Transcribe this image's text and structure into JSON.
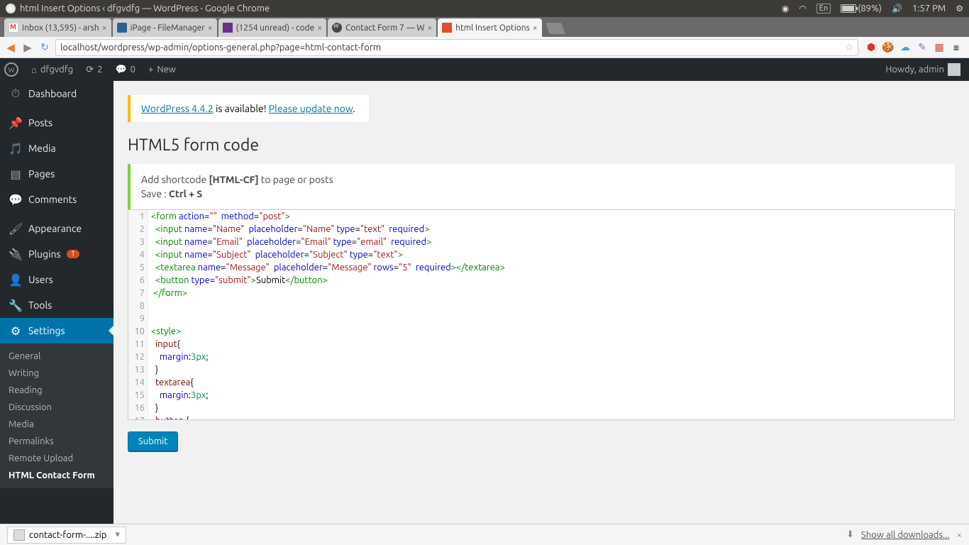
{
  "ubuntu": {
    "window_title": "html Insert Options ‹ dfgvdfg — WordPress - Google Chrome",
    "lang": "En",
    "battery": "(89%)",
    "time": "1:57 PM"
  },
  "tabs": [
    {
      "title": "Inbox (13,595) - arsh"
    },
    {
      "title": "iPage - FileManager"
    },
    {
      "title": "(1254 unread) - code"
    },
    {
      "title": "Contact Form 7 — W"
    },
    {
      "title": "html Insert Options"
    }
  ],
  "url": "localhost/wordpress/wp-admin/options-general.php?page=html-contact-form",
  "wp_bar": {
    "site": "dfgvdfg",
    "refresh": "2",
    "comments": "0",
    "new": "New",
    "howdy": "Howdy, admin"
  },
  "sidebar": {
    "dashboard": "Dashboard",
    "posts": "Posts",
    "media": "Media",
    "pages": "Pages",
    "comments": "Comments",
    "appearance": "Appearance",
    "plugins": "Plugins",
    "plugins_badge": "1",
    "users": "Users",
    "tools": "Tools",
    "settings": "Settings",
    "sub": {
      "general": "General",
      "writing": "Writing",
      "reading": "Reading",
      "discussion": "Discussion",
      "media": "Media",
      "permalinks": "Permalinks",
      "remote_upload": "Remote Upload",
      "html_contact": "HTML Contact Form"
    }
  },
  "content": {
    "nag_pre": "WordPress 4.4.2",
    "nag_mid": " is available! ",
    "nag_link": "Please update now",
    "heading": "HTML5 form code",
    "info_shortcode_pre": "Add shortcode ",
    "info_shortcode_code": "[HTML-CF]",
    "info_shortcode_post": " to page or posts",
    "info_save_pre": "Save : ",
    "info_save_key": "Ctrl + S",
    "submit": "Submit"
  },
  "code_lines": 17,
  "download": {
    "file": "contact-form-....zip",
    "show_all": "Show all downloads..."
  }
}
